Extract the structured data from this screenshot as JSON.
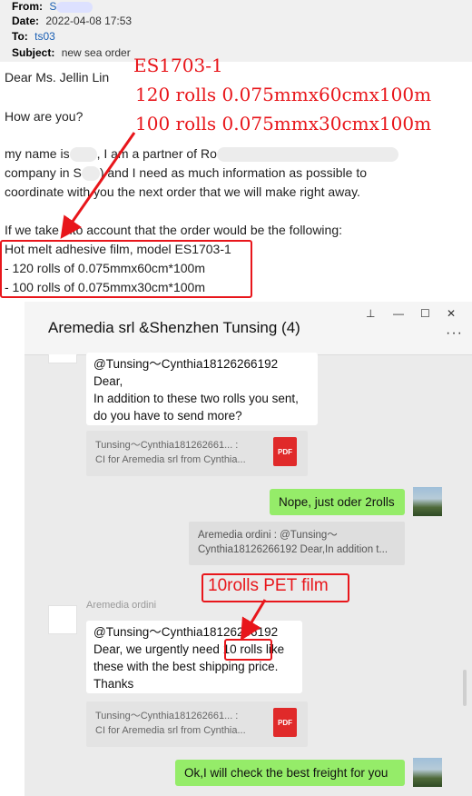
{
  "email": {
    "from_label": "From:",
    "date_label": "Date:",
    "date_value": "2022-04-08 17:53",
    "to_label": "To:",
    "to_value": "ts03",
    "subject_label": "Subject:",
    "subject_value": "new sea order",
    "greeting": "Dear Ms. Jellin Lin",
    "how_are_you": "How are you?",
    "line1_a": "my name is",
    "line1_b": ", I am a partner of Ro",
    "line2_a": "company in S",
    "line2_b": ") and I need as much information as possible to",
    "line3": "coordinate with you the next order that we will make right away.",
    "line4": "If we take into account that the order would be the following:",
    "order1": "Hot melt adhesive film, model  ES1703-1",
    "order2": "- 120 rolls of 0.075mmx60cm*100m",
    "order3": "- 100 rolls of 0.075mmx30cm*100m"
  },
  "annotations": {
    "model": "ES1703-1",
    "rolls120": "120 rolls 0.075mmx60cmx100m",
    "rolls100": "100 rolls 0.075mmx30cmx100m",
    "pet": "10rolls PET film"
  },
  "chat": {
    "title": "Aremedia srl &Shenzhen Tunsing (4)",
    "controls": {
      "pin": "⊥",
      "minimize": "—",
      "maximize": "☐",
      "close": "✕",
      "more": "···"
    },
    "msg1": {
      "lines": [
        "@Tunsing～Cynthia18126266192",
        "Dear,",
        "In addition to these two rolls you sent,",
        "do you have to send more?"
      ]
    },
    "file1": {
      "line1": "Tunsing～Cynthia181262661... :",
      "line2": "CI for Aremedia srl from Cynthia...",
      "badge": "PDF"
    },
    "msg_reply1": "Nope, just oder 2rolls",
    "quote": {
      "line1": "Aremedia ordini : @Tunsing～",
      "line2": "Cynthia18126266192 Dear,In addition t..."
    },
    "sender2": "Aremedia ordini",
    "msg2": {
      "line1": "@Tunsing～Cynthia18126266192",
      "line2_a": "Dear, we urgently need ",
      "line2_b": "10 rolls",
      "line2_c": " like",
      "line3": "these with the best shipping price.",
      "line4": "Thanks"
    },
    "file2": {
      "line1": "Tunsing～Cynthia181262661... :",
      "line2": "CI for Aremedia srl from Cynthia...",
      "badge": "PDF"
    },
    "msg_reply2": "Ok,I will check the best freight for you"
  },
  "colors": {
    "annotation_red": "#e8161b",
    "bubble_green": "#95ec69",
    "pdf_red": "#e02a2a"
  }
}
